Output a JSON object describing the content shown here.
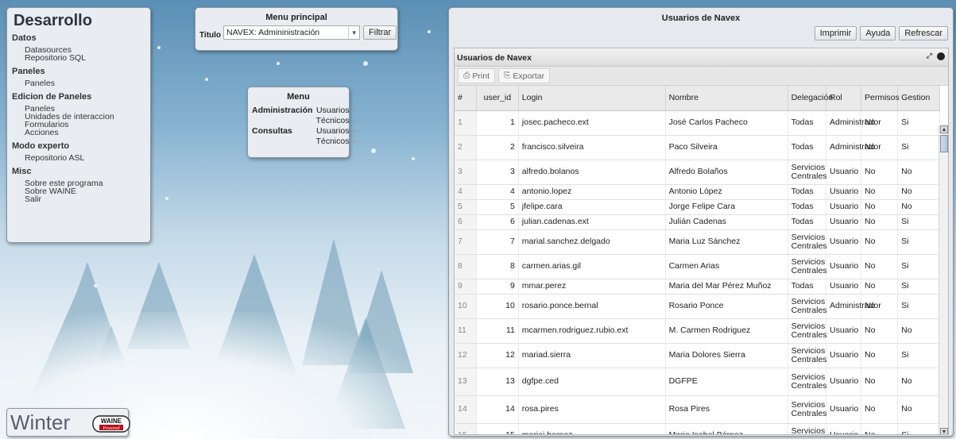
{
  "dev_panel": {
    "title": "Desarrollo",
    "sections": [
      {
        "name": "Datos",
        "items": [
          "Datasources",
          "Repositorio SQL"
        ]
      },
      {
        "name": "Paneles",
        "items": [
          "Paneles"
        ]
      },
      {
        "name": "Edicion de Paneles",
        "items": [
          "Paneles",
          "Unidades de interaccion",
          "Formularios",
          "Acciones"
        ]
      },
      {
        "name": "Modo experto",
        "items": [
          "Repositorio ASL"
        ]
      },
      {
        "name": "Misc",
        "items": [
          "Sobre este programa",
          "Sobre WAINE",
          "Salir"
        ]
      }
    ]
  },
  "menu_principal": {
    "title": "Menu principal",
    "label": "Titulo",
    "selected": "NAVEX: Admininistración",
    "filter_button": "Filtrar"
  },
  "menu": {
    "title": "Menu",
    "groups": [
      {
        "category": "Administración",
        "options": [
          "Usuarios",
          "Técnicos"
        ]
      },
      {
        "category": "Consultas",
        "options": [
          "Usuarios",
          "Técnicos"
        ]
      }
    ],
    "arrow": "⇨"
  },
  "logo": {
    "word": "Winter",
    "badge_top": "WAINE",
    "badge_bottom": "Powered"
  },
  "users_window": {
    "title": "Usuarios de Navex",
    "buttons": [
      "Imprimir",
      "Ayuda",
      "Refrescar"
    ],
    "grid_caption": "Usuarios de Navex",
    "grid_buttons": [
      "Print",
      "Exportar"
    ],
    "columns": [
      "#",
      "user_id",
      "Login",
      "Nombre",
      "Delegación",
      "Rol",
      "Permisos",
      "Gestion"
    ],
    "rows": [
      {
        "n": "1",
        "id": "1",
        "login": "josec.pacheco.ext",
        "nombre": "José Carlos Pacheco",
        "del": "Todas",
        "rol": "Administrador",
        "perm": "No",
        "gest": "Si"
      },
      {
        "n": "2",
        "id": "2",
        "login": "francisco.silveira",
        "nombre": "Paco Silveira",
        "del": "Todas",
        "rol": "Administrador",
        "perm": "No",
        "gest": "Si"
      },
      {
        "n": "3",
        "id": "3",
        "login": "alfredo.bolanos",
        "nombre": "Alfredo Bolaños",
        "del": "Servicios Centrales",
        "rol": "Usuario",
        "perm": "No",
        "gest": "No"
      },
      {
        "n": "4",
        "id": "4",
        "login": "antonio.lopez",
        "nombre": "Antonio López",
        "del": "Todas",
        "rol": "Usuario",
        "perm": "No",
        "gest": "No"
      },
      {
        "n": "5",
        "id": "5",
        "login": "jfelipe.cara",
        "nombre": "Jorge Felipe Cara",
        "del": "Todas",
        "rol": "Usuario",
        "perm": "No",
        "gest": "No"
      },
      {
        "n": "6",
        "id": "6",
        "login": "julian.cadenas.ext",
        "nombre": "Julián Cadenas",
        "del": "Todas",
        "rol": "Usuario",
        "perm": "No",
        "gest": "Si"
      },
      {
        "n": "7",
        "id": "7",
        "login": "marial.sanchez.delgado",
        "nombre": "Maria Luz Sánchez",
        "del": "Servicios Centrales",
        "rol": "Usuario",
        "perm": "No",
        "gest": "Si"
      },
      {
        "n": "8",
        "id": "8",
        "login": "carmen.arias.gil",
        "nombre": "Carmen Arias",
        "del": "Servicios Centrales",
        "rol": "Usuario",
        "perm": "No",
        "gest": "Si"
      },
      {
        "n": "9",
        "id": "9",
        "login": "mmar.perez",
        "nombre": "Maria del Mar Pérez Muñoz",
        "del": "Todas",
        "rol": "Usuario",
        "perm": "No",
        "gest": "Si"
      },
      {
        "n": "10",
        "id": "10",
        "login": "rosario.ponce.bernal",
        "nombre": "Rosario Ponce",
        "del": "Servicios Centrales",
        "rol": "Administrador",
        "perm": "No",
        "gest": "Si"
      },
      {
        "n": "11",
        "id": "11",
        "login": "mcarmen.rodriguez.rubio.ext",
        "nombre": "M. Carmen Rodriguez",
        "del": "Servicios Centrales",
        "rol": "Usuario",
        "perm": "No",
        "gest": "No"
      },
      {
        "n": "12",
        "id": "12",
        "login": "mariad.sierra",
        "nombre": "Maria Dolores Sierra",
        "del": "Servicios Centrales",
        "rol": "Usuario",
        "perm": "No",
        "gest": "Si"
      },
      {
        "n": "13",
        "id": "13",
        "login": "dgfpe.ced",
        "nombre": "DGFPE",
        "del": "Servicios Centrales",
        "rol": "Usuario",
        "perm": "No",
        "gest": "No"
      },
      {
        "n": "14",
        "id": "14",
        "login": "rosa.pires",
        "nombre": "Rosa Pires",
        "del": "Servicios Centrales",
        "rol": "Usuario",
        "perm": "No",
        "gest": "No"
      },
      {
        "n": "15",
        "id": "15",
        "login": "mariai.bornez",
        "nombre": "Maria Isabel Bórnez",
        "del": "Servicios Centrales",
        "rol": "Usuario",
        "perm": "No",
        "gest": "Si"
      }
    ]
  }
}
